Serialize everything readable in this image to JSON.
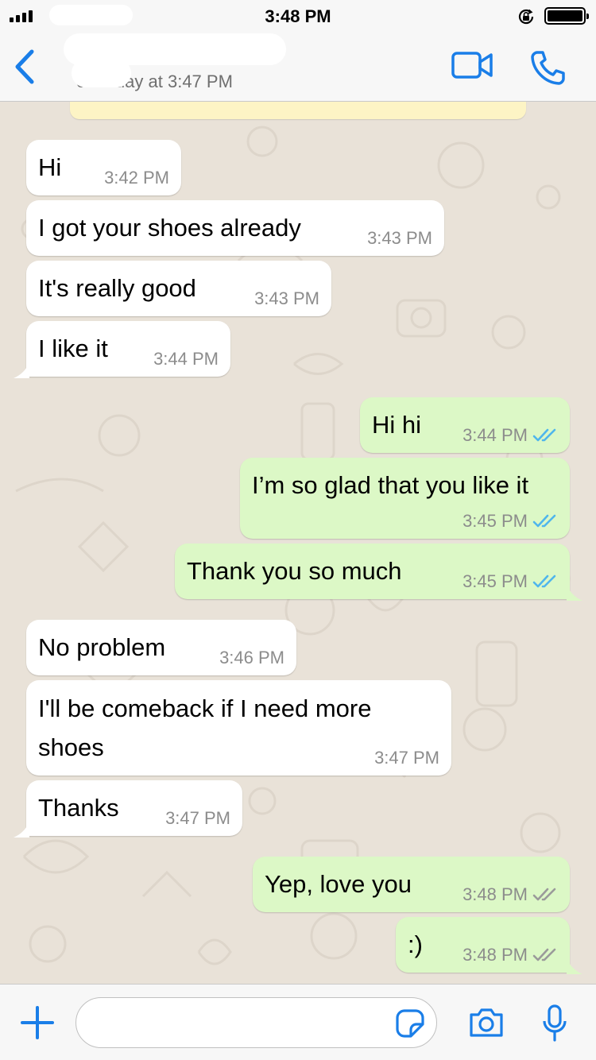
{
  "status_bar": {
    "time": "3:48 PM"
  },
  "header": {
    "last_seen": "en today at 3:47 PM"
  },
  "messages": [
    {
      "direction": "incoming",
      "text": "Hi",
      "time": "3:42 PM"
    },
    {
      "direction": "incoming",
      "text": "I got your shoes already",
      "time": "3:43 PM"
    },
    {
      "direction": "incoming",
      "text": "It's really good",
      "time": "3:43 PM"
    },
    {
      "direction": "incoming",
      "text": "I like it",
      "time": "3:44 PM"
    },
    {
      "direction": "outgoing",
      "text": "Hi hi",
      "time": "3:44 PM",
      "status": "read"
    },
    {
      "direction": "outgoing",
      "text": "I’m so glad that you like it",
      "time": "3:45 PM",
      "status": "read"
    },
    {
      "direction": "outgoing",
      "text": "Thank you so much",
      "time": "3:45 PM",
      "status": "read"
    },
    {
      "direction": "incoming",
      "text": "No problem",
      "time": "3:46 PM"
    },
    {
      "direction": "incoming",
      "text": "I'll be comeback if I need more shoes",
      "time": "3:47 PM"
    },
    {
      "direction": "incoming",
      "text": "Thanks",
      "time": "3:47 PM"
    },
    {
      "direction": "outgoing",
      "text": "Yep, love you",
      "time": "3:48 PM",
      "status": "delivered"
    },
    {
      "direction": "outgoing",
      "text": ":)",
      "time": "3:48 PM",
      "status": "delivered"
    }
  ],
  "colors": {
    "accent": "#1a7ee8",
    "read_ticks": "#4fb6ec",
    "delivered_ticks": "#9a9a9a",
    "incoming_bubble": "#ffffff",
    "outgoing_bubble": "#dcf8c6",
    "chat_background": "#e9e2d8"
  },
  "icons": {
    "back": "chevron-left-icon",
    "video_call": "video-camera-icon",
    "voice_call": "phone-icon",
    "attach": "plus-icon",
    "sticker": "sticker-icon",
    "camera": "camera-icon",
    "voice_note": "microphone-icon"
  }
}
